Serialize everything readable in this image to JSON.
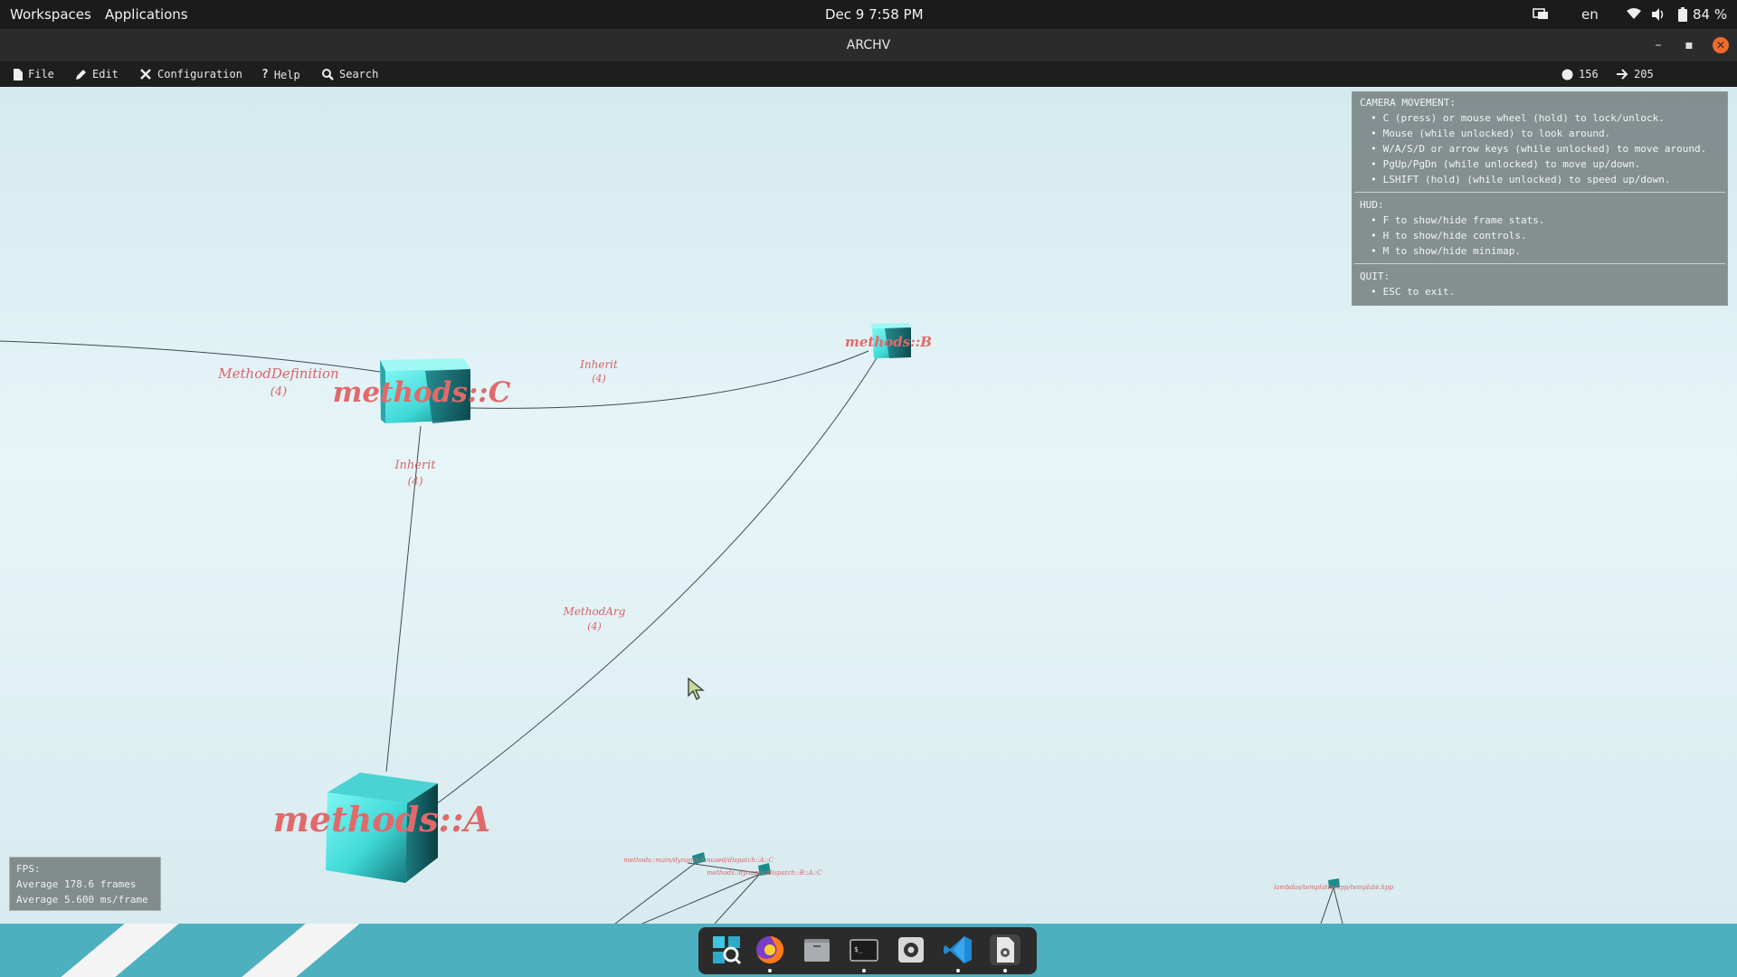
{
  "system_bar": {
    "workspaces": "Workspaces",
    "applications": "Applications",
    "clock": "Dec 9  7:58 PM",
    "keyboard_layout": "en",
    "battery": "84 %"
  },
  "window": {
    "title": "ARCHV"
  },
  "menubar": {
    "file": "File",
    "edit": "Edit",
    "configuration": "Configuration",
    "help": "Help",
    "search": "Search",
    "node_count": "156",
    "edge_count": "205"
  },
  "scene": {
    "nodes": {
      "c": "methods::C",
      "b": "methods::B",
      "a": "methods::A"
    },
    "edges": {
      "method_definition": {
        "label": "MethodDefinition",
        "count": "(4)"
      },
      "inherit_cb": {
        "label": "Inherit",
        "count": "(4)"
      },
      "inherit_ca": {
        "label": "Inherit",
        "count": "(4)"
      },
      "method_arg": {
        "label": "MethodArg",
        "count": "(4)"
      }
    },
    "far_labels": {
      "cluster1_line1": "methods::main/dynamic/unused/dispatch::A::C",
      "cluster1_line2": "methods::dynamic/dispatch::B::A::C",
      "cluster2": "lambdas/templates/cpp/template.hpp"
    }
  },
  "help_panel": {
    "camera_heading": "CAMERA MOVEMENT:",
    "camera_items": [
      "C (press) or mouse wheel (hold) to lock/unlock.",
      "Mouse (while unlocked) to look around.",
      "W/A/S/D or arrow keys (while unlocked) to move around.",
      "PgUp/PgDn (while unlocked) to move up/down.",
      "LSHIFT (hold) (while unlocked) to speed up/down."
    ],
    "hud_heading": "HUD:",
    "hud_items": [
      "F to show/hide frame stats.",
      "H to show/hide controls.",
      "M to show/hide minimap."
    ],
    "quit_heading": "QUIT:",
    "quit_items": [
      "ESC to exit."
    ]
  },
  "fps_panel": {
    "heading": "FPS:",
    "frames": "Average 178.6 frames",
    "ms": "Average 5.600 ms/frame"
  },
  "dock": {
    "apps": [
      "search-app",
      "firefox",
      "files",
      "terminal",
      "settings",
      "vscode",
      "archv"
    ]
  },
  "colors": {
    "cube_light": "#5ff1ef",
    "cube_dark": "#0f5a5e",
    "label_red": "#e06a6a",
    "panel_bg": "#7a8484"
  }
}
